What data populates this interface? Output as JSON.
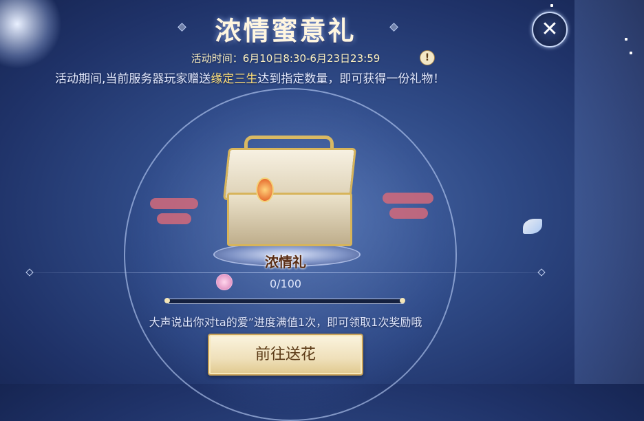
{
  "title": "浓情蜜意礼",
  "activity_time": "活动时间：6月10日8:30-6月23日23:59",
  "info_icon_glyph": "!",
  "description_prefix": "活动期间,当前服务器玩家赠送",
  "description_highlight": "缘定三生",
  "description_suffix": "达到指定数量，即可获得一份礼物！",
  "reward": {
    "name": "浓情礼",
    "icon": "treasure-chest-icon"
  },
  "progress": {
    "text": "0/100",
    "current": 0,
    "max": 100,
    "fraction": 0.0
  },
  "hint": "大声说出你对ta的爱”进度满值1次，即可领取1次奖励哦",
  "go_button_label": "前往送花",
  "close_icon_glyph": "✕",
  "colors": {
    "accent_gold": "#ffe07a",
    "background": "#2f4a86",
    "button_text": "#5b3a16"
  }
}
